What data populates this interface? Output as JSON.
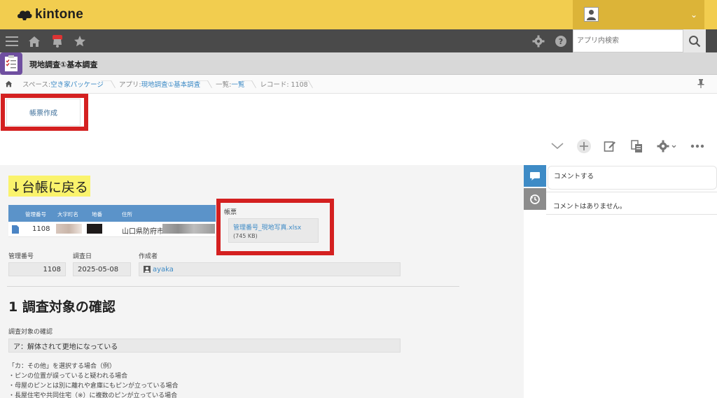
{
  "header": {
    "logo_text": "kintone",
    "brand_color": "#f2cd4f",
    "user_menu_icon": "user-icon",
    "chevron_icon": "chevron-down-icon"
  },
  "nav": {
    "icons": [
      "menu-icon",
      "home-icon",
      "notification-bell-icon",
      "star-icon",
      "gear-icon",
      "help-icon",
      "search-icon"
    ],
    "search_placeholder": "アプリ内検索"
  },
  "app": {
    "title": "現地調査①基本調査",
    "icon": "checklist-app-icon"
  },
  "breadcrumb": {
    "items": [
      {
        "prefix": "スペース: ",
        "link": "空き家パッケージ"
      },
      {
        "prefix": "アプリ: ",
        "link": "現地調査①基本調査"
      },
      {
        "prefix": "一覧: ",
        "link": "一覧"
      },
      {
        "prefix": "レコード: 1108",
        "link": ""
      }
    ]
  },
  "toolbar": {
    "report_button": "帳票作成",
    "icons": [
      "chevron-down-icon",
      "add-icon",
      "edit-icon",
      "copy-icon",
      "gear-icon",
      "more-icon"
    ]
  },
  "record": {
    "back_label": "↓台帳に戻る",
    "ref_table": {
      "headers": [
        "管理番号",
        "大字町名",
        "地番",
        "住所"
      ],
      "row": {
        "id": "1108",
        "address": "山口県防府市"
      }
    },
    "report_field": {
      "label": "帳票",
      "file_name": "管理番号_現地写真.xlsx",
      "file_size": "(745 KB)"
    },
    "fields": {
      "id_label": "管理番号",
      "id_value": "1108",
      "date_label": "調査日",
      "date_value": "2025-05-08",
      "author_label": "作成者",
      "author_value": "ayaka"
    },
    "section_title": "1 調査対象の確認",
    "target_label": "調査対象の確認",
    "target_value": "ア：解体されて更地になっている",
    "notes": [
      "「カ：その他」を選択する場合（例）",
      "・ピンの位置が誤っていると疑われる場合",
      "・母屋のピンとは別に離れや倉庫にもピンが立っている場合",
      "・長屋住宅や共同住宅（※）に複数のピンが立っている場合"
    ]
  },
  "comments": {
    "input_placeholder": "コメントする",
    "empty_text": "コメントはありません。",
    "tab_icons": [
      "comment-icon",
      "history-icon"
    ]
  }
}
